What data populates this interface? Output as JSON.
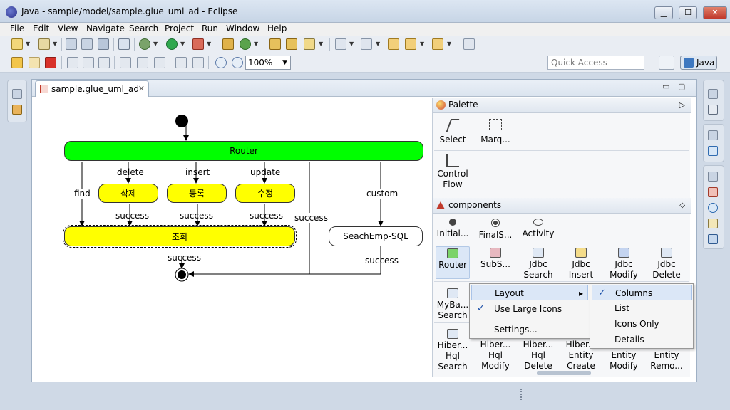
{
  "window": {
    "title": "Java - sample/model/sample.glue_uml_ad - Eclipse",
    "min": "▁",
    "max": "☐",
    "close": "✕"
  },
  "menu": [
    "File",
    "Edit",
    "View",
    "Navigate",
    "Search",
    "Project",
    "Run",
    "Window",
    "Help"
  ],
  "toolbar": {
    "zoom": "100%",
    "quick_access_placeholder": "Quick Access",
    "perspective_label": "Java"
  },
  "editor": {
    "tab_label": "sample.glue_uml_ad",
    "tab_close": "✕",
    "minimize": "▭",
    "maximize": "▢"
  },
  "diagram": {
    "router": "Router",
    "delete_label": "delete",
    "insert_label": "insert",
    "update_label": "update",
    "find_label": "find",
    "custom_label": "custom",
    "delete_action": "삭제",
    "insert_action": "등록",
    "update_action": "수정",
    "query_action": "조회",
    "seachemp_action": "SeachEmp-SQL",
    "success": "success"
  },
  "palette": {
    "title": "Palette",
    "tools": [
      "Select",
      "Marq..."
    ],
    "control_flow": [
      "Control",
      "Flow"
    ],
    "components_title": "components",
    "components_row1": [
      "Initial...",
      "FinalS...",
      "Activity"
    ],
    "components_row2": [
      [
        "Router",
        ""
      ],
      [
        "SubS...",
        ""
      ],
      [
        "Jdbc",
        "Search"
      ],
      [
        "Jdbc",
        "Insert"
      ],
      [
        "Jdbc",
        "Modify"
      ],
      [
        "Jdbc",
        "Delete"
      ]
    ],
    "components_row3": [
      "MyBa...",
      "Search"
    ],
    "components_row4": [
      [
        "Hiber...",
        "Hql",
        "Search"
      ],
      [
        "Hiber...",
        "Hql",
        "Modify"
      ],
      [
        "Hiber...",
        "Hql",
        "Delete"
      ],
      [
        "Hiber...",
        "Entity",
        "Create"
      ],
      [
        "Entity",
        "Modify"
      ],
      [
        "Entity",
        "Remo..."
      ]
    ]
  },
  "context_menu": {
    "main": [
      "Layout",
      "Use Large Icons",
      "Settings..."
    ],
    "submenu_arrow": "▸",
    "layout_submenu": [
      "Columns",
      "List",
      "Icons Only",
      "Details"
    ],
    "check": "✓"
  },
  "colors": {
    "router": "#00ff00",
    "action": "#ffff00",
    "final": "#ffffff"
  }
}
